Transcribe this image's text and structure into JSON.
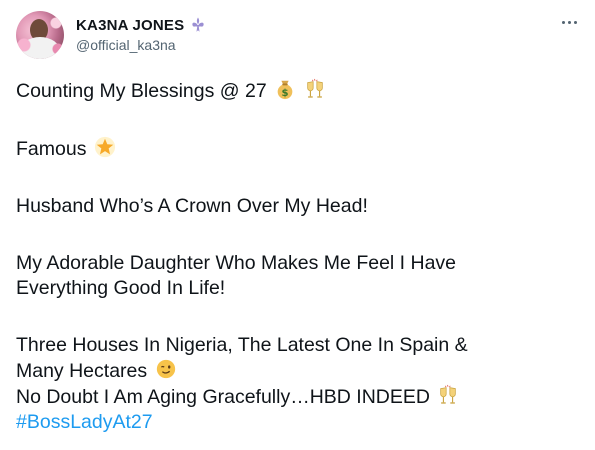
{
  "user": {
    "display_name": "KA3NA JONES",
    "handle": "@official_ka3na",
    "badge_icon": "fleur-de-lis-icon",
    "badge_color": "#9b8fd3"
  },
  "tweet": {
    "line1": "Counting My Blessings @ 27",
    "line2": "Famous",
    "line3": "Husband Who’s A Crown Over My Head!",
    "line4a": "My Adorable Daughter Who Makes Me Feel I Have",
    "line4b": "Everything Good In Life!",
    "line5a": "Three Houses In Nigeria, The Latest One In Spain &",
    "line5b": "Many Hectares",
    "line6": "No Doubt I Am Aging Gracefully…HBD INDEED",
    "hashtag": "#BossLadyAt27",
    "hashtag_color": "#1d9bf0"
  },
  "icons": {
    "money_bag": "money-bag-icon",
    "clinking_glasses": "clinking-glasses-icon",
    "glowing_star": "glowing-star-icon",
    "winking_face": "winking-face-icon",
    "more": "more-options-icon"
  }
}
